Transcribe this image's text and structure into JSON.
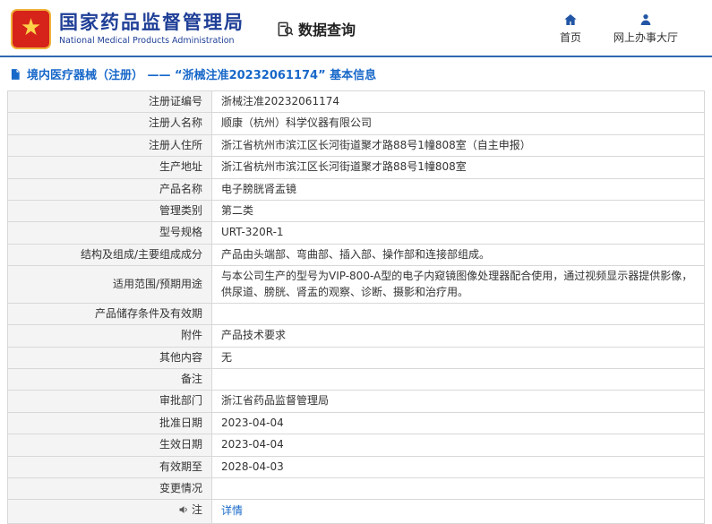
{
  "header": {
    "org_name_cn": "国家药品监督管理局",
    "org_name_en": "National Medical Products Administration",
    "section_title": "数据查询",
    "nav_home": "首页",
    "nav_service_hall": "网上办事大厅"
  },
  "breadcrumb": {
    "text": "境内医疗器械（注册） —— “浙械注准20232061174” 基本信息"
  },
  "icons": {
    "national-emblem-logo": "red-gold national emblem",
    "data-query-icon": "document-with-magnifier",
    "home-icon": "house",
    "user-icon": "person",
    "document-icon": "document page",
    "speaker-icon": "loudspeaker"
  },
  "colors": {
    "brand_blue": "#1f3f97",
    "link_blue": "#1868c9",
    "divider_blue": "#2e68b1",
    "emblem_red": "#d6241a",
    "emblem_gold": "#f0b43c",
    "label_bg": "#f4f4f4",
    "table_border": "#d8d8d8"
  },
  "table": {
    "rows": [
      {
        "label": "注册证编号",
        "value": "浙械注准20232061174"
      },
      {
        "label": "注册人名称",
        "value": "顺康（杭州）科学仪器有限公司"
      },
      {
        "label": "注册人住所",
        "value": "浙江省杭州市滨江区长河街道聚才路88号1幢808室（自主申报）"
      },
      {
        "label": "生产地址",
        "value": "浙江省杭州市滨江区长河街道聚才路88号1幢808室"
      },
      {
        "label": "产品名称",
        "value": "电子膀胱肾盂镜"
      },
      {
        "label": "管理类别",
        "value": "第二类"
      },
      {
        "label": "型号规格",
        "value": "URT-320R-1"
      },
      {
        "label": "结构及组成/主要组成成分",
        "value": "产品由头端部、弯曲部、插入部、操作部和连接部组成。"
      },
      {
        "label": "适用范围/预期用途",
        "value": "与本公司生产的型号为VIP-800-A型的电子内窥镜图像处理器配合使用，通过视频显示器提供影像，供尿道、膀胱、肾盂的观察、诊断、摄影和治疗用。"
      },
      {
        "label": "产品储存条件及有效期",
        "value": ""
      },
      {
        "label": "附件",
        "value": "产品技术要求"
      },
      {
        "label": "其他内容",
        "value": "无"
      },
      {
        "label": "备注",
        "value": ""
      },
      {
        "label": "审批部门",
        "value": "浙江省药品监督管理局"
      },
      {
        "label": "批准日期",
        "value": "2023-04-04"
      },
      {
        "label": "生效日期",
        "value": "2023-04-04"
      },
      {
        "label": "有效期至",
        "value": "2028-04-03"
      },
      {
        "label": "变更情况",
        "value": ""
      },
      {
        "label": "注",
        "label_icon": "speaker-icon",
        "value": "详情",
        "link": true
      }
    ]
  }
}
